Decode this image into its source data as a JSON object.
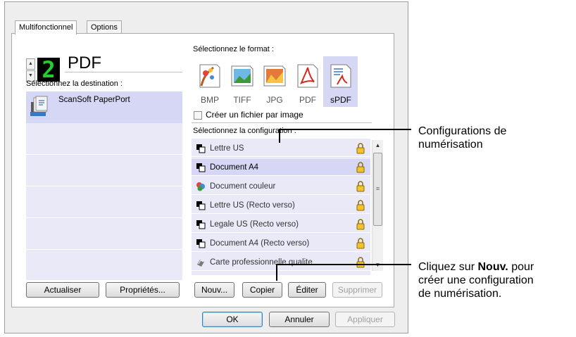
{
  "tabs": {
    "multi": "Multifonctionnel",
    "options": "Options"
  },
  "counter": {
    "digit": "2",
    "label": "PDF"
  },
  "destination": {
    "heading": "Sélectionnez la destination :",
    "items": [
      "ScanSoft PaperPort"
    ],
    "refresh": "Actualiser",
    "properties": "Propriétés..."
  },
  "format": {
    "heading": "Sélectionnez le format :",
    "options": [
      "BMP",
      "TIFF",
      "JPG",
      "PDF",
      "sPDF"
    ],
    "selected": "sPDF",
    "checkbox_label": "Créer un fichier par image",
    "checkbox_checked": false
  },
  "config": {
    "heading": "Sélectionnez la configuration :",
    "items": [
      "Lettre US",
      "Document A4",
      "Document couleur",
      "Lettre US (Recto verso)",
      "Legale US (Recto verso)",
      "Document A4 (Recto verso)",
      "Carte professionnelle qualite"
    ],
    "selected": "Document A4",
    "new": "Nouv...",
    "copy": "Copier",
    "edit": "Éditer",
    "delete": "Supprimer"
  },
  "dialog": {
    "ok": "OK",
    "cancel": "Annuler",
    "apply": "Appliquer"
  },
  "callouts": {
    "config_line1": "Configurations de",
    "config_line2": "numérisation",
    "new_line1_prefix": "Cliquez sur ",
    "new_line1_bold": "Nouv.",
    "new_line1_suffix": " pour",
    "new_line2": "créer une configuration",
    "new_line3": "de numérisation."
  },
  "colors": {
    "selection": "#d6d6f5",
    "list_bg": "#e9e9f8",
    "counter_green": "#1fd12a",
    "window_bg": "#eeeeee"
  }
}
